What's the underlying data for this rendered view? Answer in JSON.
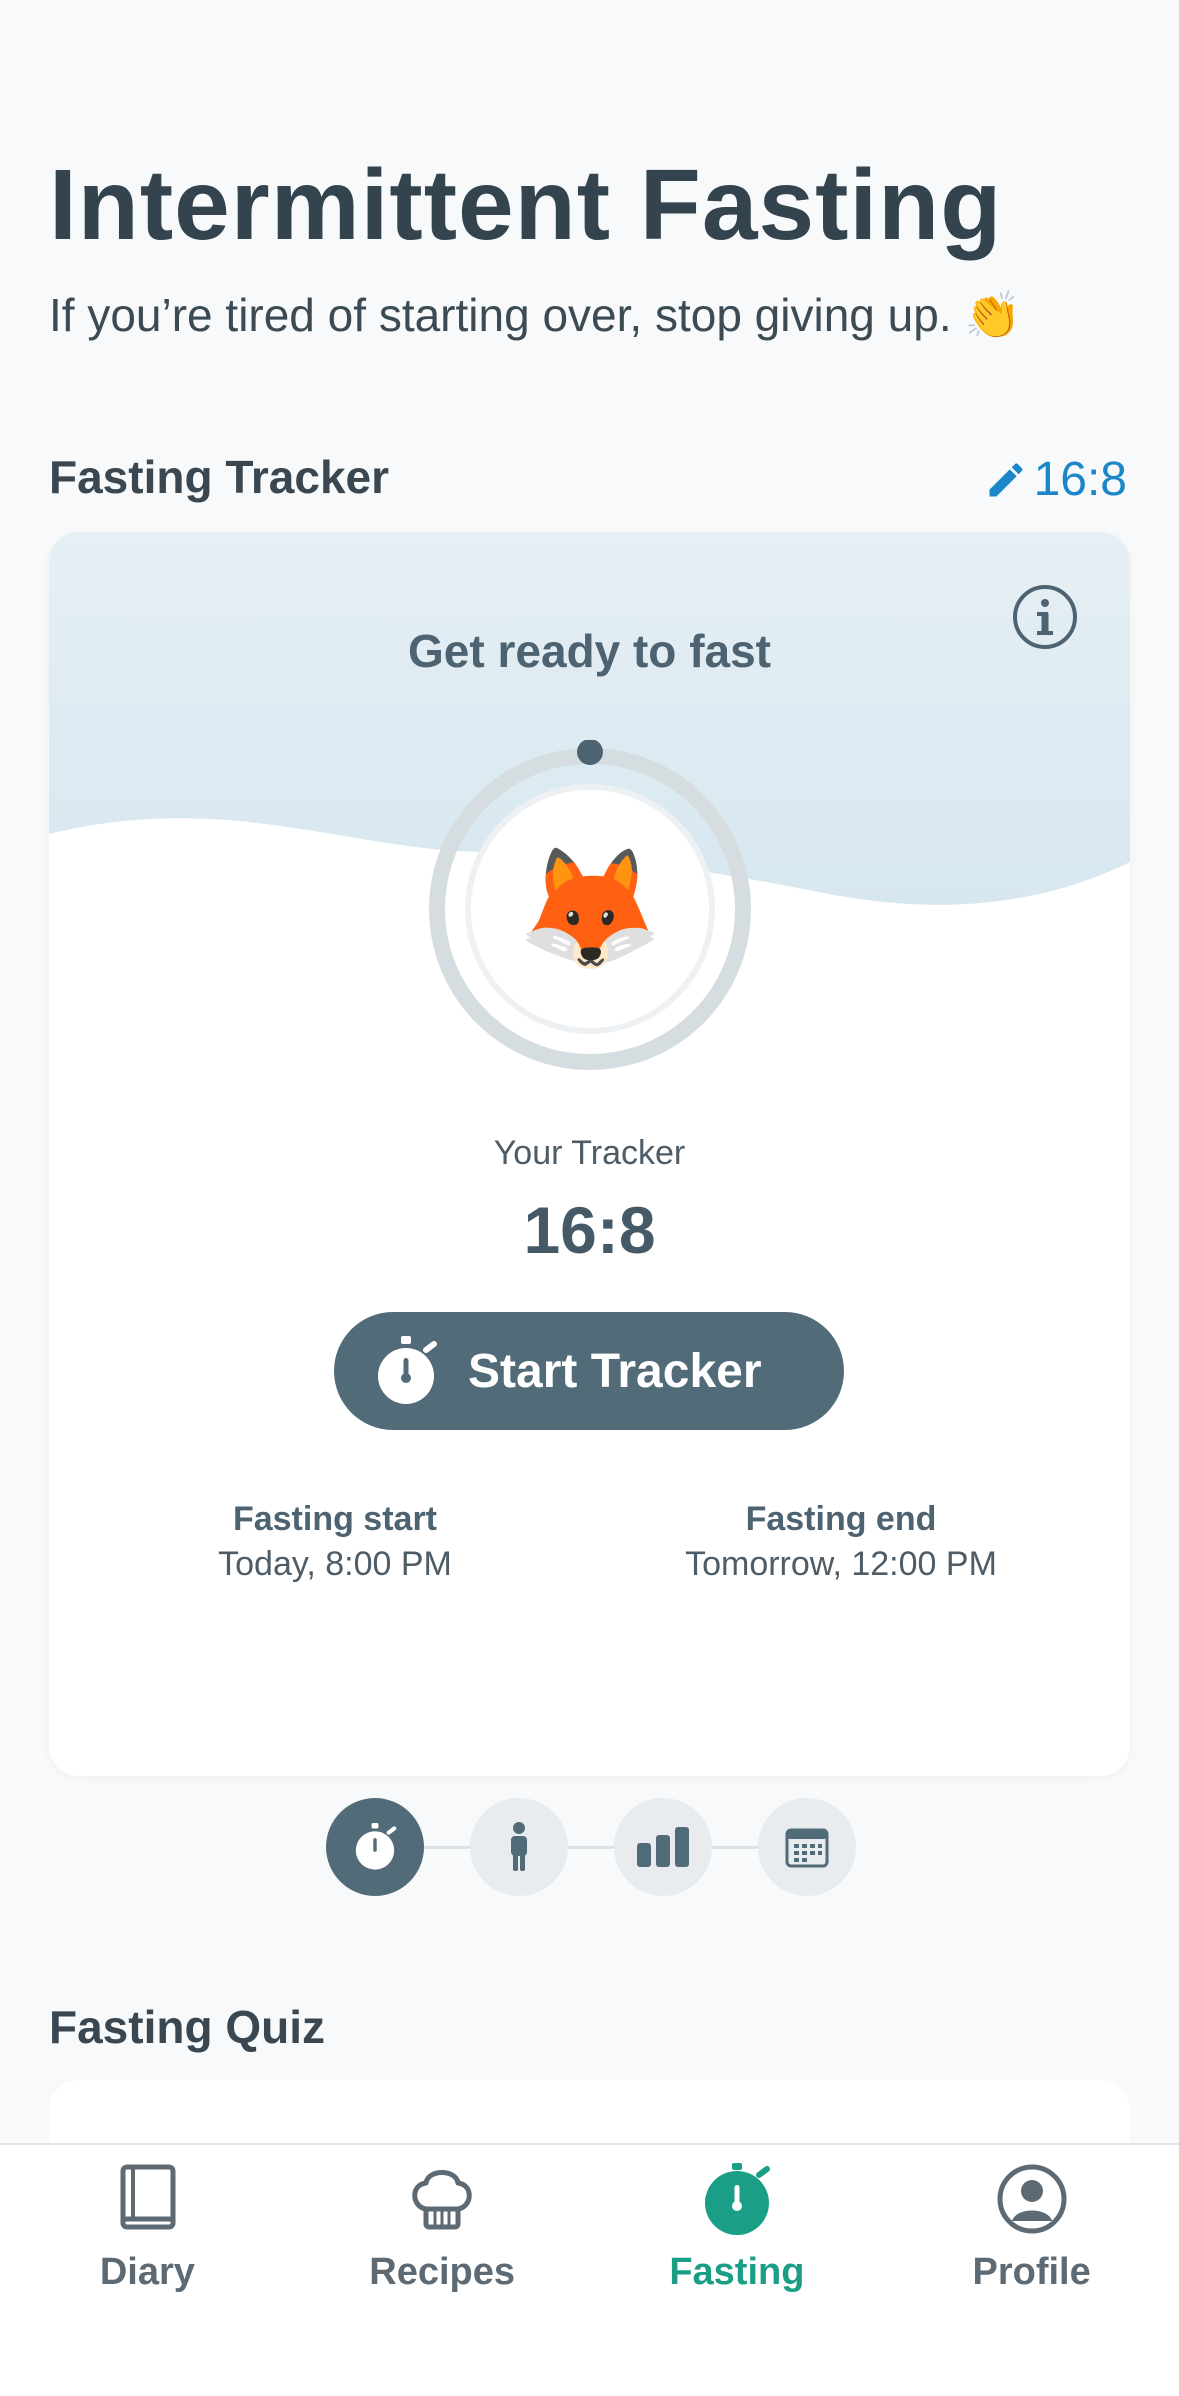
{
  "header": {
    "title": "Intermittent Fasting",
    "subtitle": "If you’re tired of starting over, stop giving up. 👏"
  },
  "tracker_section": {
    "title": "Fasting Tracker",
    "plan": "16:8"
  },
  "tracker_card": {
    "status": "Get ready to fast",
    "mascot": "🦊",
    "tracker_label": "Your Tracker",
    "tracker_value": "16:8",
    "start_button": "Start Tracker",
    "fasting_start_label": "Fasting start",
    "fasting_start_value": "Today, 8:00 PM",
    "fasting_end_label": "Fasting end",
    "fasting_end_value": "Tomorrow, 12:00 PM",
    "progress": 0
  },
  "pager": {
    "items": [
      "stopwatch-icon",
      "person-icon",
      "bar-chart-icon",
      "calendar-icon"
    ],
    "active_index": 0
  },
  "quiz_section": {
    "title": "Fasting Quiz"
  },
  "tabbar": {
    "items": [
      {
        "label": "Diary",
        "icon": "book-icon"
      },
      {
        "label": "Recipes",
        "icon": "chef-hat-icon"
      },
      {
        "label": "Fasting",
        "icon": "stopwatch-icon"
      },
      {
        "label": "Profile",
        "icon": "user-circle-icon"
      }
    ],
    "active": "Fasting"
  },
  "colors": {
    "accent": "#1a9f86",
    "link": "#1b87c9",
    "button": "#526b78",
    "text": "#34444f"
  }
}
